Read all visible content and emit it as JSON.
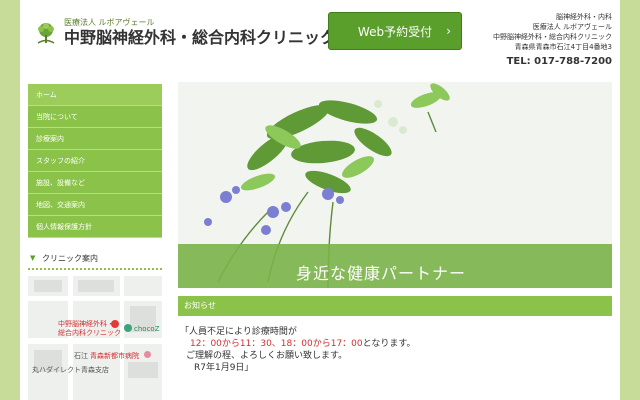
{
  "header": {
    "logo_sub": "医療法人 ルボアヴェール",
    "logo_main": "中野脳神経外科・総合内科クリニック",
    "web_button": "Web予約受付",
    "web_button_chevron": "›",
    "address_lines": [
      "脳神経外科・内科",
      "医療法人 ルボアヴェール",
      "中野脳神経外科・総合内科クリニック",
      "青森県青森市石江4丁目4番地3"
    ],
    "tel": "TEL: 017-788-7200"
  },
  "sidebar": {
    "items": [
      {
        "label": "ホーム"
      },
      {
        "label": "当院について"
      },
      {
        "label": "診療案内"
      },
      {
        "label": "スタッフの紹介"
      },
      {
        "label": "施設、設備など"
      },
      {
        "label": "地図、交通案内"
      },
      {
        "label": "個人情報保護方針"
      }
    ],
    "clinic_heading": "クリニック案内"
  },
  "map": {
    "label_clinic_1": "中野脳神経外科・",
    "label_clinic_2": "総合内科クリニック",
    "label_choco": "chocoZ",
    "label_ishie": "石江",
    "label_hospital": "青森新都市病院",
    "label_store": "丸ハダイレクト青森支店"
  },
  "hero": {
    "tagline": "身近な健康パートナー"
  },
  "news": {
    "heading": "お知らせ",
    "line1": "「人員不足により診療時間が",
    "line2_red": "12：00から11：30、18：00から17：00",
    "line2_rest": "となります。",
    "line3": "ご理解の程、よろしくお願い致します。",
    "line4": "R7年1月9日」"
  },
  "colors": {
    "accent": "#8bc34a",
    "button": "#5a9e2c",
    "background": "#c6dc98",
    "notice_red": "#d12f2f"
  }
}
